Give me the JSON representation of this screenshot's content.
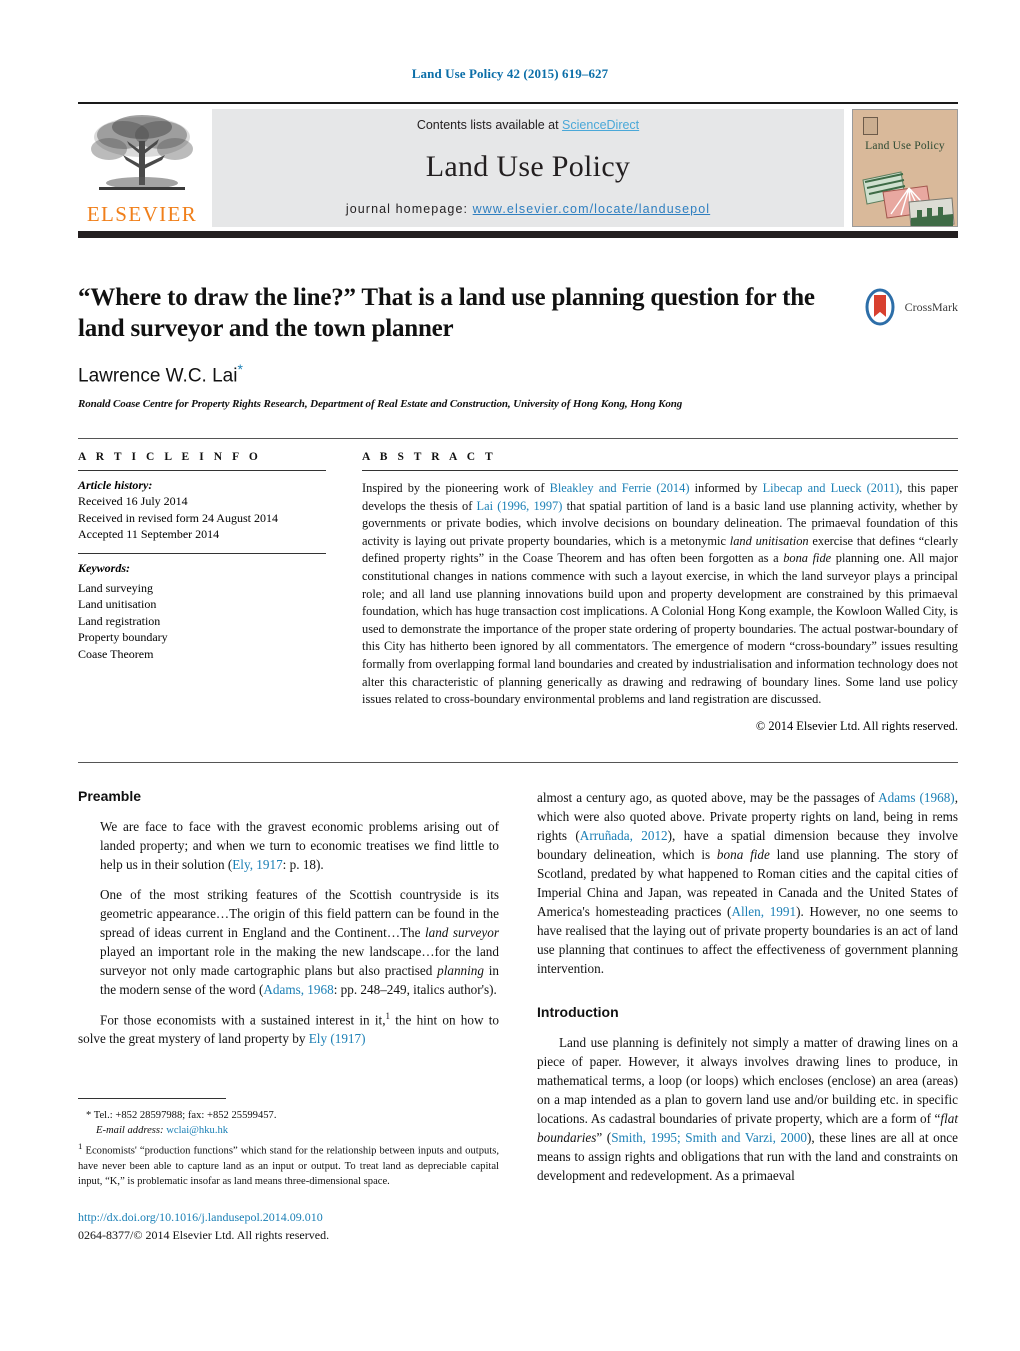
{
  "running_head": "Land Use Policy 42 (2015) 619–627",
  "masthead": {
    "contents_prefix": "Contents lists available at ",
    "sciencedirect": "ScienceDirect",
    "journal_title": "Land Use Policy",
    "homepage_prefix": "journal homepage: ",
    "homepage_url": "www.elsevier.com/locate/landusepol",
    "publisher_wordmark": "ELSEVIER",
    "cover_title": "Land Use Policy",
    "accent_blue": "#4aa8d8",
    "link_blue": "#2f7fc0",
    "elsevier_orange": "#f07f1a",
    "panel_grey": "#e6e7e8",
    "cover_tan": "#d9b99a"
  },
  "title_block": {
    "title": "“Where to draw the line?” That is a land use planning question for the land surveyor and the town planner",
    "author": "Lawrence W.C. Lai",
    "author_marker": "*",
    "affiliation": "Ronald Coase Centre for Property Rights Research, Department of Real Estate and Construction, University of Hong Kong, Hong Kong",
    "crossmark_label": "CrossMark"
  },
  "article_info": {
    "heading": "A R T I C L E  I N F O",
    "history_label": "Article history:",
    "history": [
      "Received 16 July 2014",
      "Received in revised form 24 August 2014",
      "Accepted 11 September 2014"
    ],
    "keywords_label": "Keywords:",
    "keywords": [
      "Land surveying",
      "Land unitisation",
      "Land registration",
      "Property boundary",
      "Coase Theorem"
    ]
  },
  "abstract": {
    "heading": "A B S T R A C T",
    "paragraph_html": "Inspired by the pioneering work of <span class=\"ref\">Bleakley and Ferrie (2014)</span> informed by <span class=\"ref\">Libecap and Lueck (2011)</span>, this paper develops the thesis of <span class=\"ref\">Lai (1996, 1997)</span> that spatial partition of land is a basic land use planning activity, whether by governments or private bodies, which involve decisions on boundary delineation. The primaeval foundation of this activity is laying out private property boundaries, which is a metonymic <i>land unitisation</i> exercise that defines “clearly defined property rights” in the Coase Theorem and has often been forgotten as a <i>bona fide</i> planning one. All major constitutional changes in nations commence with such a layout exercise, in which the land surveyor plays a principal role; and all land use planning innovations build upon and property development are constrained by this primaeval foundation, which has huge transaction cost implications. A Colonial Hong Kong example, the Kowloon Walled City, is used to demonstrate the importance of the proper state ordering of property boundaries. The actual postwar-boundary of this City has hitherto been ignored by all commentators. The emergence of modern “cross-boundary” issues resulting formally from overlapping formal land boundaries and created by industrialisation and information technology does not alter this characteristic of planning generically as drawing and redrawing of boundary lines. Some land use policy issues related to cross-boundary environmental problems and land registration are discussed.",
    "copyright": "© 2014 Elsevier Ltd. All rights reserved."
  },
  "body": {
    "left_column": {
      "section_heading": "Preamble",
      "quote1_html": "We are face to face with the gravest economic problems arising out of landed property; and when we turn to economic treatises we find little to help us in their solution (<span class=\"ref\">Ely, 1917</span>: p. 18).",
      "quote2_html": "One of the most striking features of the Scottish countryside is its geometric appearance…The origin of this field pattern can be found in the spread of ideas current in England and the Continent…The <i>land surveyor</i> played an important role in the making the new landscape…for the land surveyor not only made cartographic plans but also practised <i>planning</i> in the modern sense of the word (<span class=\"ref\">Adams, 1968</span>: pp. 248–249, italics author's).",
      "para1_html": "For those economists with a sustained interest in it,<sup>1</sup> the hint on how to solve the great mystery of land property by <span class=\"ref\">Ely (1917)</span>"
    },
    "right_column": {
      "para_continued_html": "almost a century ago, as quoted above, may be the passages of <span class=\"ref\">Adams (1968)</span>, which were also quoted above. Private property rights on land, being in rems rights (<span class=\"ref\">Arruñada, 2012</span>), have a spatial dimension because they involve boundary delineation, which is <i>bona fide</i> land use planning. The story of Scotland, predated by what happened to Roman cities and the capital cities of Imperial China and Japan, was repeated in Canada and the United States of America's homesteading practices (<span class=\"ref\">Allen, 1991</span>). However, no one seems to have realised that the laying out of private property boundaries is an act of land use planning that continues to affect the effectiveness of government planning intervention.",
      "section_heading": "Introduction",
      "para2_html": "Land use planning is definitely not simply a matter of drawing lines on a piece of paper. However, it always involves drawing lines to produce, in mathematical terms, a loop (or loops) which encloses (enclose) an area (areas) on a map intended as a plan to govern land use and/or building etc. in specific locations. As cadastral boundaries of private property, which are a form of “<i>flat boundaries</i>” (<span class=\"ref\">Smith, 1995; Smith and Varzi, 2000</span>), these lines are all at once means to assign rights and obligations that run with the land and constraints on development and redevelopment. As a primaeval"
    }
  },
  "footnotes": {
    "tel_line": "*  Tel.: +852 28597988; fax: +852 25599457.",
    "email_label": "E-mail address:",
    "email": "wclai@hku.hk",
    "note1_html": "<sup>1</sup> Economists' “production functions” which stand for the relationship between inputs and outputs, have never been able to capture land as an input or output. To treat land as depreciable capital input, “K,” is problematic insofar as land means three-dimensional space."
  },
  "footer": {
    "doi": "http://dx.doi.org/10.1016/j.landusepol.2014.09.010",
    "issn_line": "0264-8377/© 2014 Elsevier Ltd. All rights reserved."
  }
}
